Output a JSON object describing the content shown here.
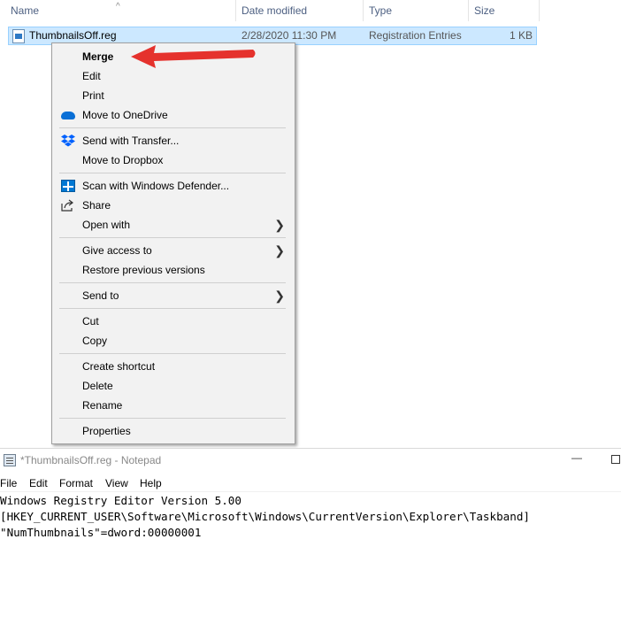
{
  "explorer": {
    "columns": {
      "name": "Name",
      "date": "Date modified",
      "type": "Type",
      "size": "Size"
    },
    "sort_caret": "^",
    "file": {
      "name": "ThumbnailsOff.reg",
      "date": "2/28/2020 11:30 PM",
      "type": "Registration Entries",
      "size": "1 KB",
      "icon": "reg-file-icon"
    }
  },
  "context_menu": {
    "items": [
      {
        "label": "Merge"
      },
      {
        "label": "Edit"
      },
      {
        "label": "Print"
      },
      {
        "label": "Move to OneDrive",
        "icon": "onedrive-icon"
      },
      {
        "label": "Send with Transfer...",
        "icon": "dropbox-icon"
      },
      {
        "label": "Move to Dropbox"
      },
      {
        "label": "Scan with Windows Defender...",
        "icon": "defender-icon"
      },
      {
        "label": "Share",
        "icon": "share-icon"
      },
      {
        "label": "Open with"
      },
      {
        "label": "Give access to"
      },
      {
        "label": "Restore previous versions"
      },
      {
        "label": "Send to"
      },
      {
        "label": "Cut"
      },
      {
        "label": "Copy"
      },
      {
        "label": "Create shortcut"
      },
      {
        "label": "Delete"
      },
      {
        "label": "Rename"
      },
      {
        "label": "Properties"
      }
    ],
    "submenu_glyph": "❯"
  },
  "annotation": {
    "arrow_color": "#e5322d"
  },
  "notepad": {
    "title": "*ThumbnailsOff.reg - Notepad",
    "minimize_glyph": "—",
    "menus": [
      "File",
      "Edit",
      "Format",
      "View",
      "Help"
    ],
    "lines": [
      "Windows Registry Editor Version 5.00",
      "",
      "[HKEY_CURRENT_USER\\Software\\Microsoft\\Windows\\CurrentVersion\\Explorer\\Taskband]",
      "\"NumThumbnails\"=dword:00000001"
    ]
  }
}
